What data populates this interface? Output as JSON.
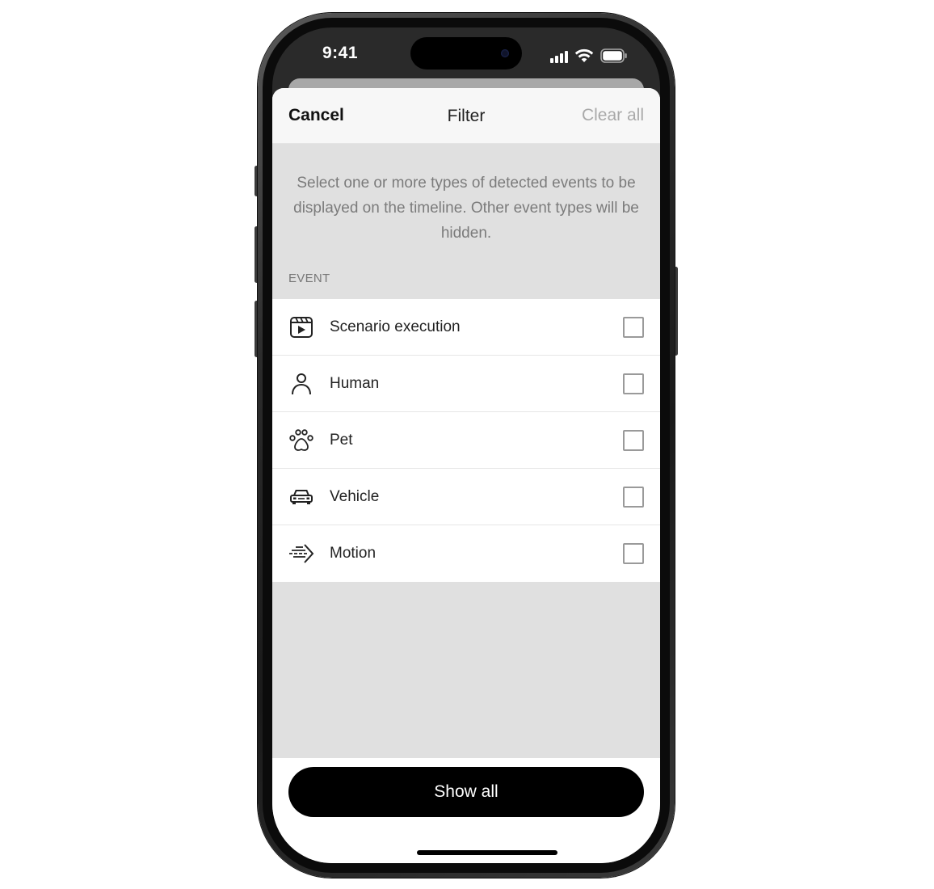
{
  "status_bar": {
    "time": "9:41"
  },
  "nav": {
    "cancel_label": "Cancel",
    "title": "Filter",
    "clear_label": "Clear all"
  },
  "description": "Select one or more types of detected events to be displayed on the timeline. Other event types will be hidden.",
  "section": {
    "header": "EVENT"
  },
  "events": [
    {
      "label": "Scenario execution",
      "icon": "scenario-icon",
      "checked": false
    },
    {
      "label": "Human",
      "icon": "person-icon",
      "checked": false
    },
    {
      "label": "Pet",
      "icon": "paw-icon",
      "checked": false
    },
    {
      "label": "Vehicle",
      "icon": "car-icon",
      "checked": false
    },
    {
      "label": "Motion",
      "icon": "motion-icon",
      "checked": false
    }
  ],
  "footer": {
    "show_all_label": "Show all"
  },
  "colors": {
    "sheet_background": "#e0e0e0",
    "primary_button": "#000000",
    "disabled_text": "#a9a9a9"
  }
}
